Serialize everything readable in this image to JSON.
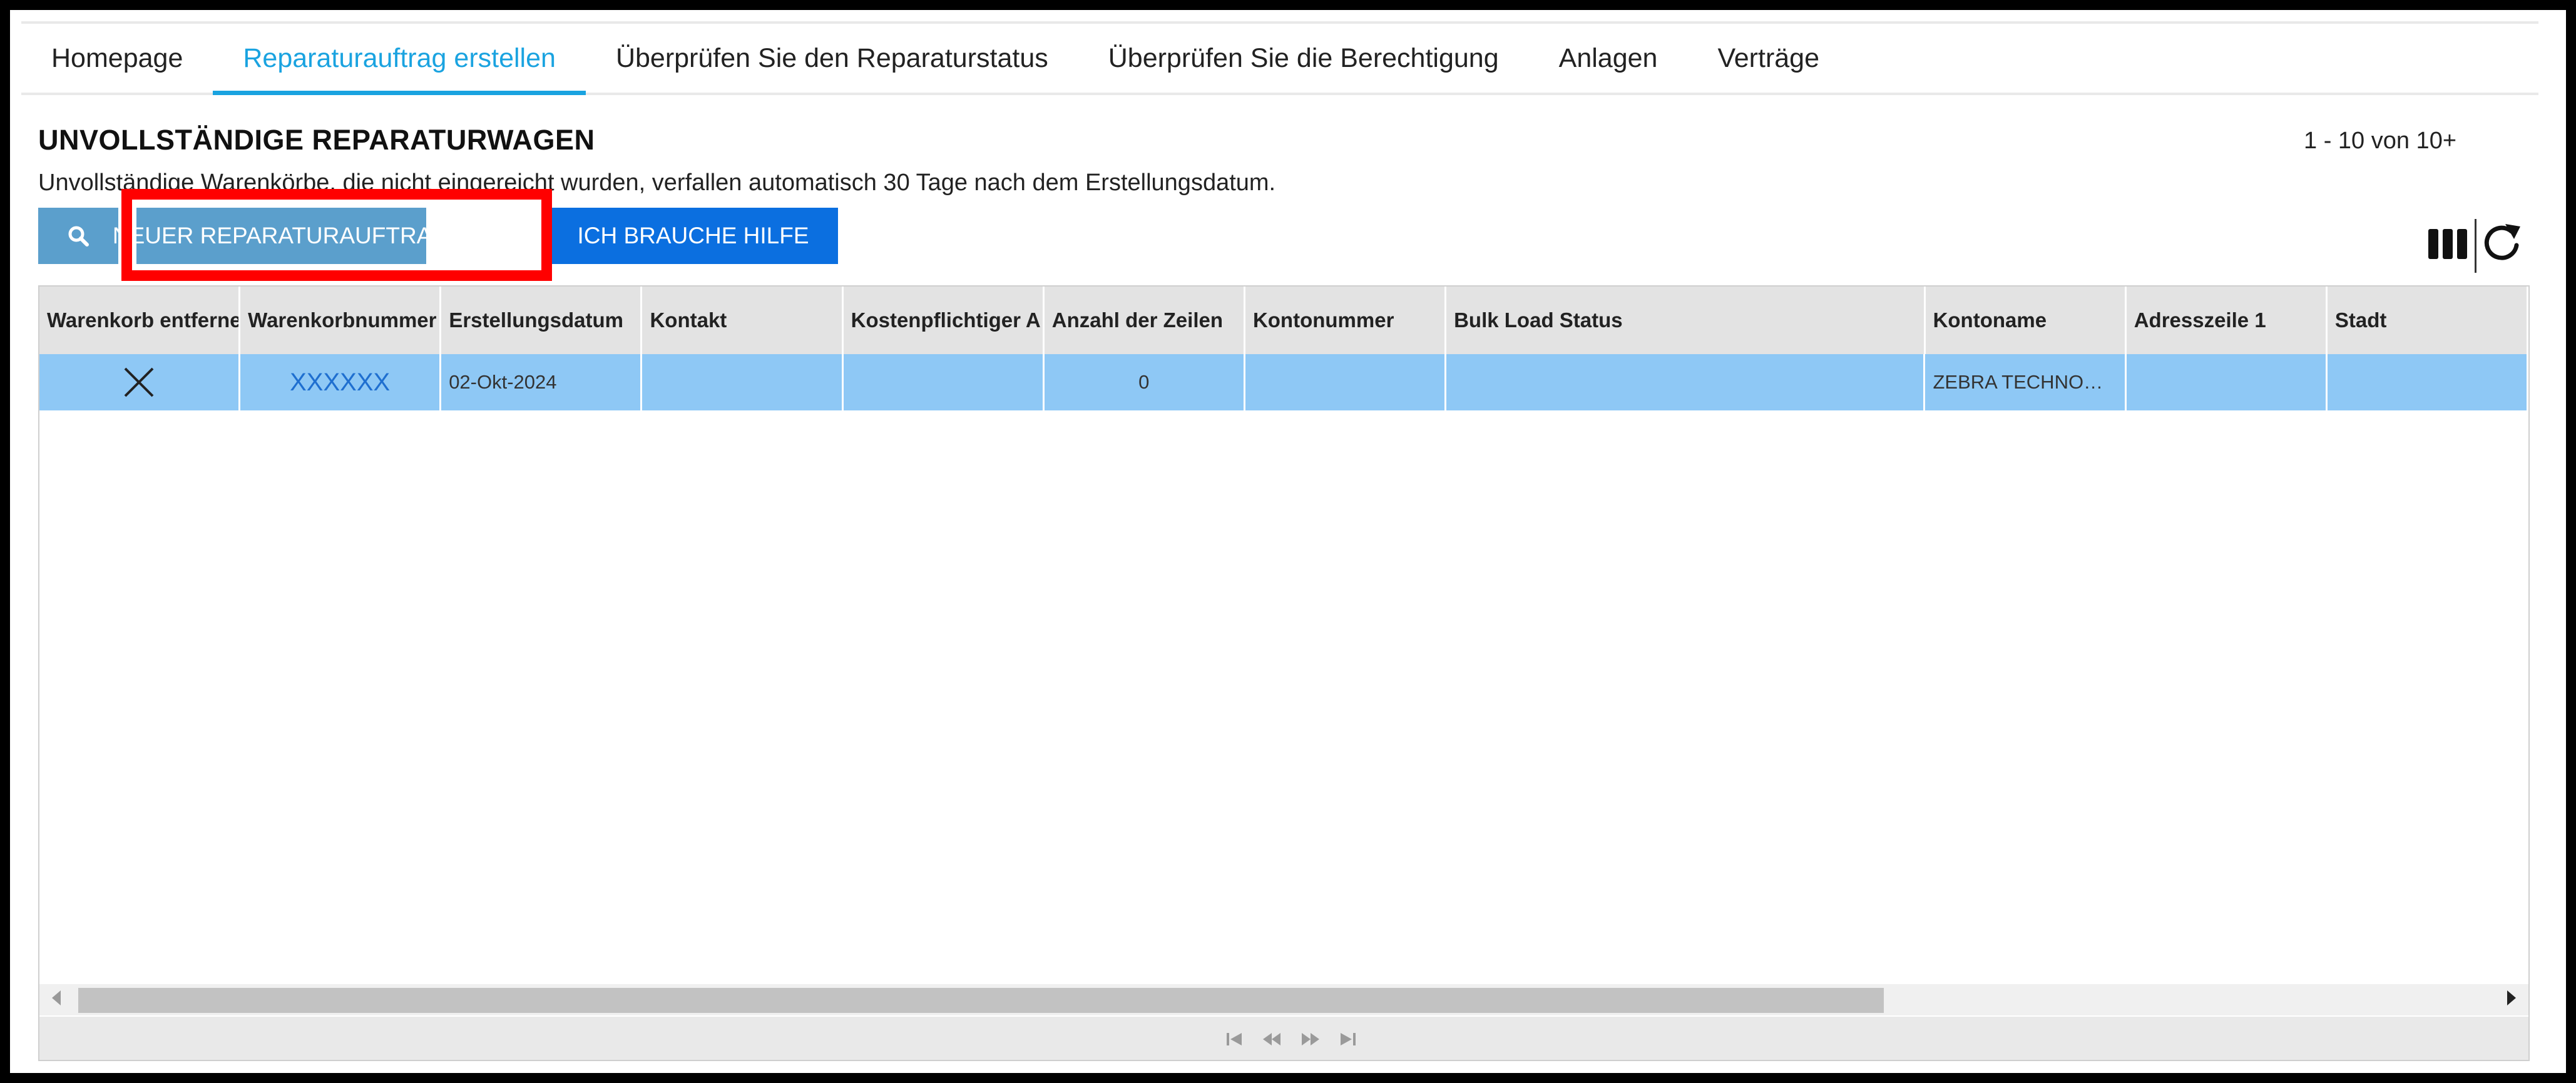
{
  "nav": {
    "tabs": [
      {
        "label": "Homepage"
      },
      {
        "label": "Reparaturauftrag erstellen",
        "active": true
      },
      {
        "label": "Überprüfen Sie den Reparaturstatus"
      },
      {
        "label": "Überprüfen Sie die Berechtigung"
      },
      {
        "label": "Anlagen"
      },
      {
        "label": "Verträge"
      }
    ]
  },
  "header": {
    "title": "UNVOLLSTÄNDIGE REPARATURWAGEN",
    "subtitle": "Unvollständige Warenkörbe, die nicht eingereicht wurden, verfallen automatisch 30 Tage nach dem Erstellungsdatum.",
    "page_info": "1 - 10 von 10+"
  },
  "toolbar": {
    "search_icon": "search-icon",
    "new_label": "NEUER REPARATURAUFTRAG",
    "help_label": "ICH BRAUCHE HILFE",
    "columns_icon": "columns-icon",
    "refresh_icon": "refresh-icon"
  },
  "grid": {
    "columns": [
      "Warenkorb entferne",
      "Warenkorbnummer",
      "Erstellungsdatum",
      "Kontakt",
      "Kostenpflichtiger A",
      "Anzahl der Zeilen",
      "Kontonummer",
      "Bulk Load Status",
      "Kontoname",
      "Adresszeile 1",
      "Stadt"
    ],
    "rows": [
      {
        "remove_icon": "close-icon",
        "cart_number": "XXXXXX",
        "created": "02-Okt-2024",
        "contact": "",
        "billable": "",
        "line_count": "0",
        "account_number": "",
        "bulk_load_status": "",
        "account_name": "ZEBRA TECHNO…",
        "address1": "",
        "city": ""
      }
    ]
  },
  "colors": {
    "accent": "#1aa3e0",
    "button": "#5b9fcc",
    "help_button": "#0b6fe0",
    "selected_row": "#8ec8f5",
    "highlight": "#ff0000"
  }
}
